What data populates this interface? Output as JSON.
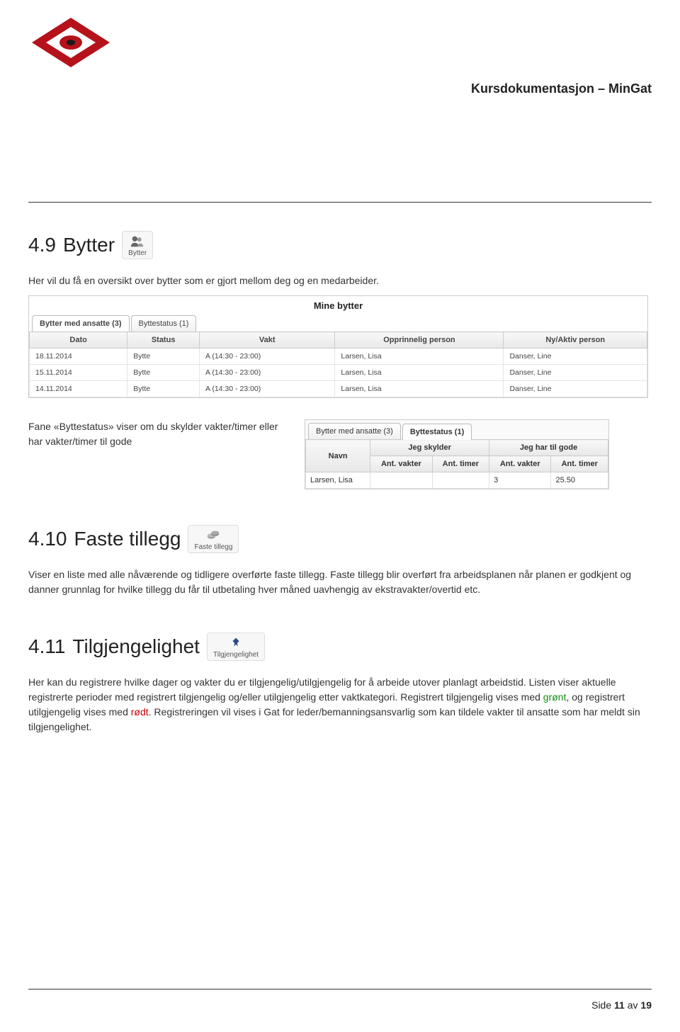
{
  "doc_title": "Kursdokumentasjon – MinGat",
  "sections": {
    "s49": {
      "number": "4.9",
      "title": "Bytter",
      "chip": "Bytter",
      "intro": "Her vil du få en oversikt over bytter som er gjort mellom deg og en medarbeider.",
      "screenshot_title": "Mine bytter",
      "tabs": {
        "t1": "Bytter med ansatte (3)",
        "t2": "Byttestatus (1)"
      },
      "cols": {
        "c1": "Dato",
        "c2": "Status",
        "c3": "Vakt",
        "c4": "Opprinnelig person",
        "c5": "Ny/Aktiv person"
      },
      "rows": [
        {
          "dato": "18.11.2014",
          "status": "Bytte",
          "vakt": "A (14:30 - 23:00)",
          "opp": "Larsen, Lisa",
          "ny": "Danser, Line"
        },
        {
          "dato": "15.11.2014",
          "status": "Bytte",
          "vakt": "A (14:30 - 23:00)",
          "opp": "Larsen, Lisa",
          "ny": "Danser, Line"
        },
        {
          "dato": "14.11.2014",
          "status": "Bytte",
          "vakt": "A (14:30 - 23:00)",
          "opp": "Larsen, Lisa",
          "ny": "Danser, Line"
        }
      ],
      "para2": "Fane «Byttestatus» viser om du skylder vakter/timer eller har vakter/timer til gode",
      "s2": {
        "tabs": {
          "t1": "Bytter med ansatte (3)",
          "t2": "Byttestatus (1)"
        },
        "head": {
          "navn": "Navn",
          "skylder": "Jeg skylder",
          "gode": "Jeg har til gode"
        },
        "sub": {
          "av": "Ant. vakter",
          "at": "Ant. timer"
        },
        "row": {
          "navn": "Larsen, Lisa",
          "sv": "",
          "st": "",
          "gv": "3",
          "gt": "25.50"
        }
      }
    },
    "s410": {
      "number": "4.10",
      "title": "Faste tillegg",
      "chip": "Faste tillegg",
      "body": "Viser en liste med alle nåværende og tidligere overførte faste tillegg. Faste tillegg blir overført fra arbeidsplanen når planen er godkjent og danner grunnlag for hvilke tillegg du får til utbetaling hver måned uavhengig av ekstravakter/overtid etc."
    },
    "s411": {
      "number": "4.11",
      "title": "Tilgjengelighet",
      "chip": "Tilgjengelighet",
      "body_pre": "Her kan du registrere hvilke dager og vakter du er tilgjengelig/utilgjengelig for å arbeide utover planlagt arbeidstid. Listen viser aktuelle registrerte perioder med registrert tilgjengelig og/eller utilgjengelig etter vaktkategori. Registrert tilgjengelig vises med ",
      "green": "grønt",
      "mid": ", og registrert utilgjengelig vises med ",
      "red": "rødt",
      "body_post": ". Registreringen vil vises i Gat for leder/bemanningsansvarlig som kan tildele vakter til ansatte som har meldt sin tilgjengelighet."
    }
  },
  "footer": {
    "pre": "Side ",
    "cur": "11",
    "mid": " av ",
    "tot": "19"
  }
}
